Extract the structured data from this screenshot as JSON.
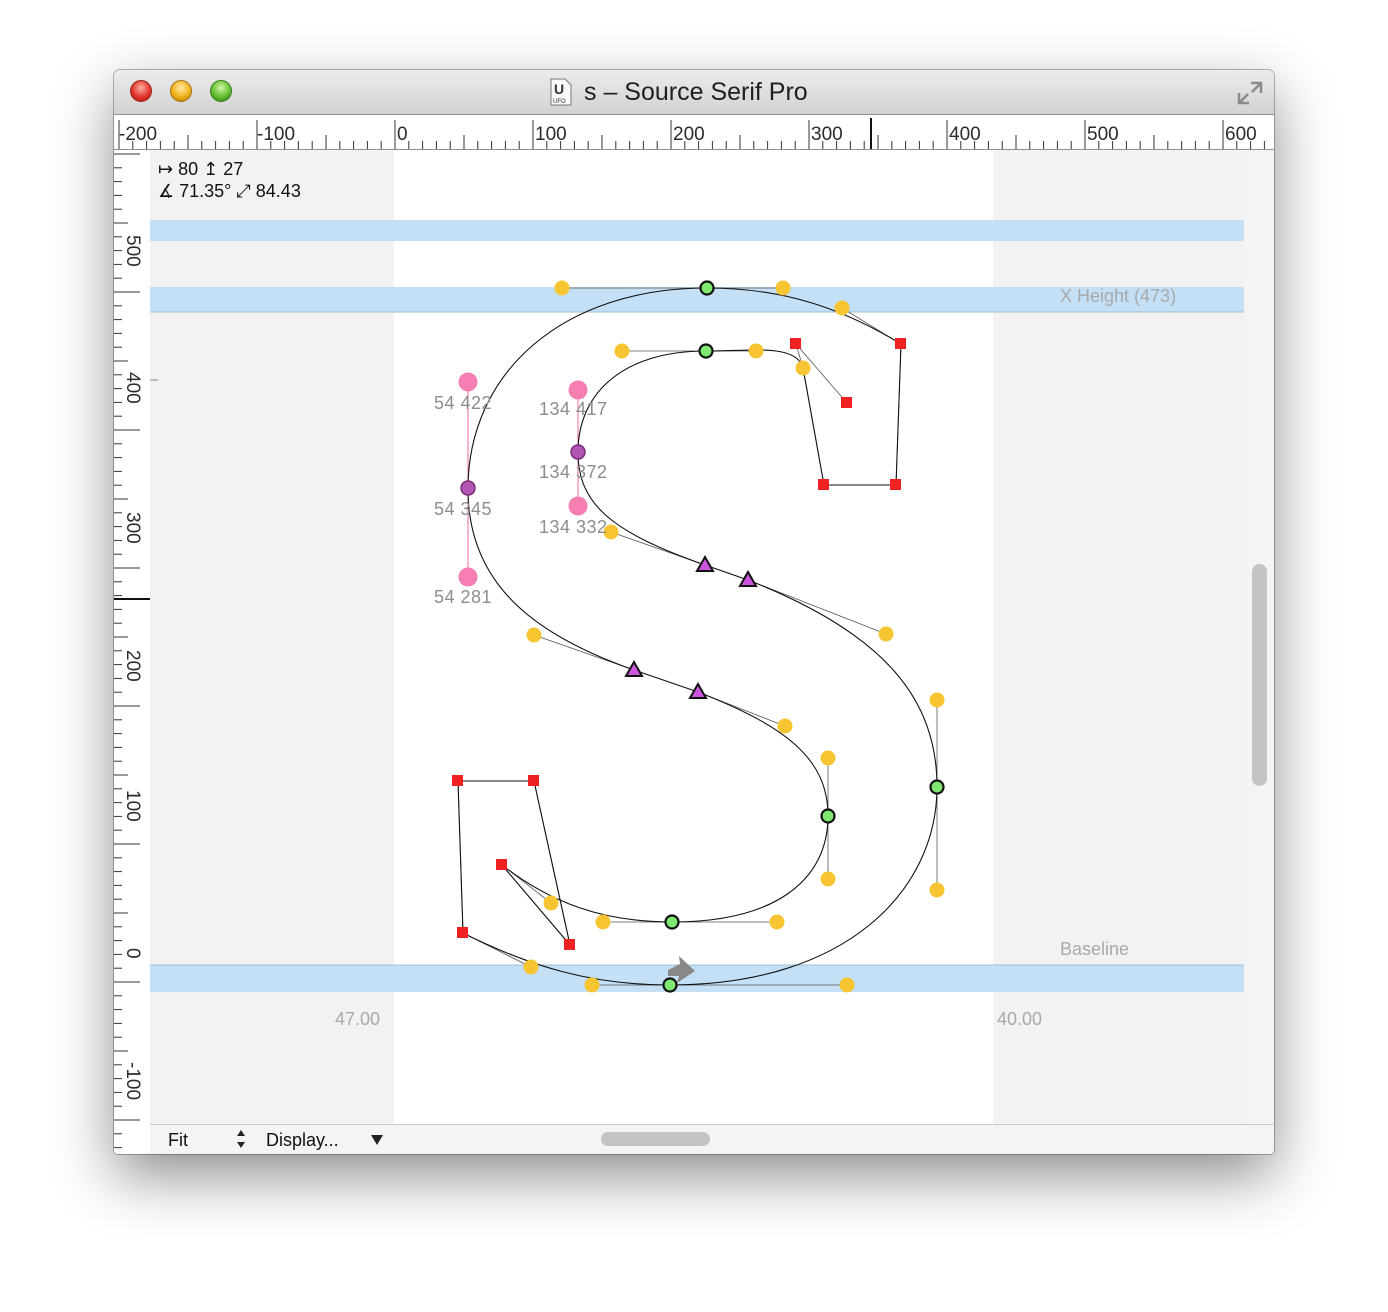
{
  "window": {
    "title": "s – Source Serif Pro",
    "doc_icon_letter": "U",
    "doc_icon_badge": "UFO"
  },
  "ruler": {
    "horizontal": [
      "-200",
      "-100",
      "0",
      "100",
      "200",
      "300",
      "400",
      "500",
      "600"
    ],
    "vertical": [
      "500",
      "400",
      "300",
      "200",
      "100",
      "0",
      "-100"
    ]
  },
  "readout": {
    "line1": "↦ 80 ↥ 27",
    "line2": "∡ 71.35° ⤢ 84.43"
  },
  "guides": {
    "x_height": "X Height (473)",
    "baseline": "Baseline"
  },
  "metrics": {
    "left_sidebearing": "47.00",
    "right_sidebearing": "40.00"
  },
  "coordinate_labels": [
    "54  422",
    "54  345",
    "54  281",
    "134  417",
    "134  372",
    "134  332"
  ],
  "colors": {
    "guide_band": "#c3e0f7",
    "on_curve_smooth": "#7ee871",
    "off_curve": "#f7c531",
    "corner": "#ee2222",
    "triangle": "#cc55dd",
    "measure_handle": "#f77eb3",
    "measure_center": "#b356b3"
  },
  "bottombar": {
    "zoom": "Fit",
    "display": "Display..."
  }
}
